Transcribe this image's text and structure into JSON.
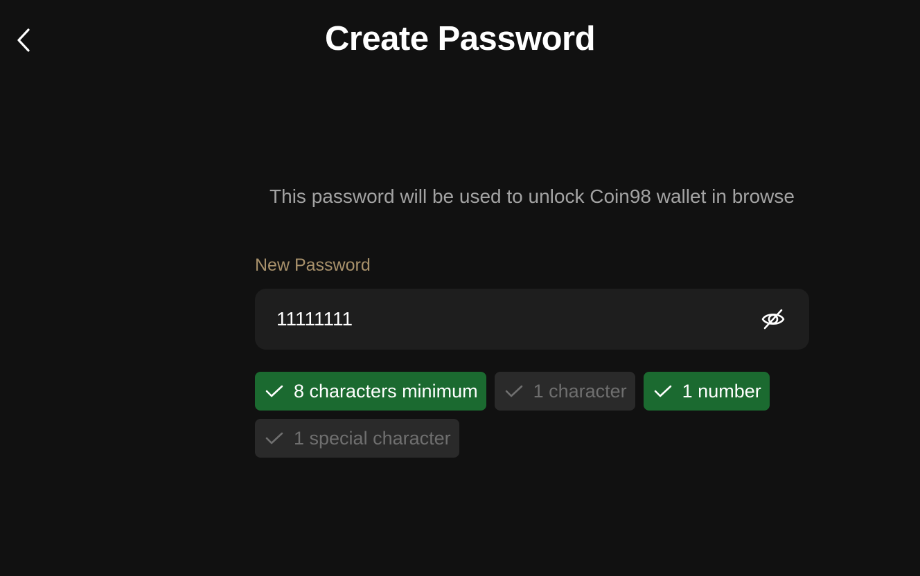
{
  "header": {
    "title": "Create Password",
    "back_icon": "chevron-left-icon"
  },
  "main": {
    "subtitle": "This password will be used to unlock Coin98 wallet in browse",
    "password_label": "New Password",
    "password_value": "11111111",
    "visibility_icon": "eye-off-icon"
  },
  "requirements": [
    {
      "label": "8 characters minimum",
      "met": true
    },
    {
      "label": "1 character",
      "met": false
    },
    {
      "label": "1 number",
      "met": true
    },
    {
      "label": "1 special character",
      "met": false
    }
  ],
  "colors": {
    "background": "#111111",
    "met": "#1b6a30",
    "unmet": "#2a2a2a",
    "label": "#a8916b"
  }
}
